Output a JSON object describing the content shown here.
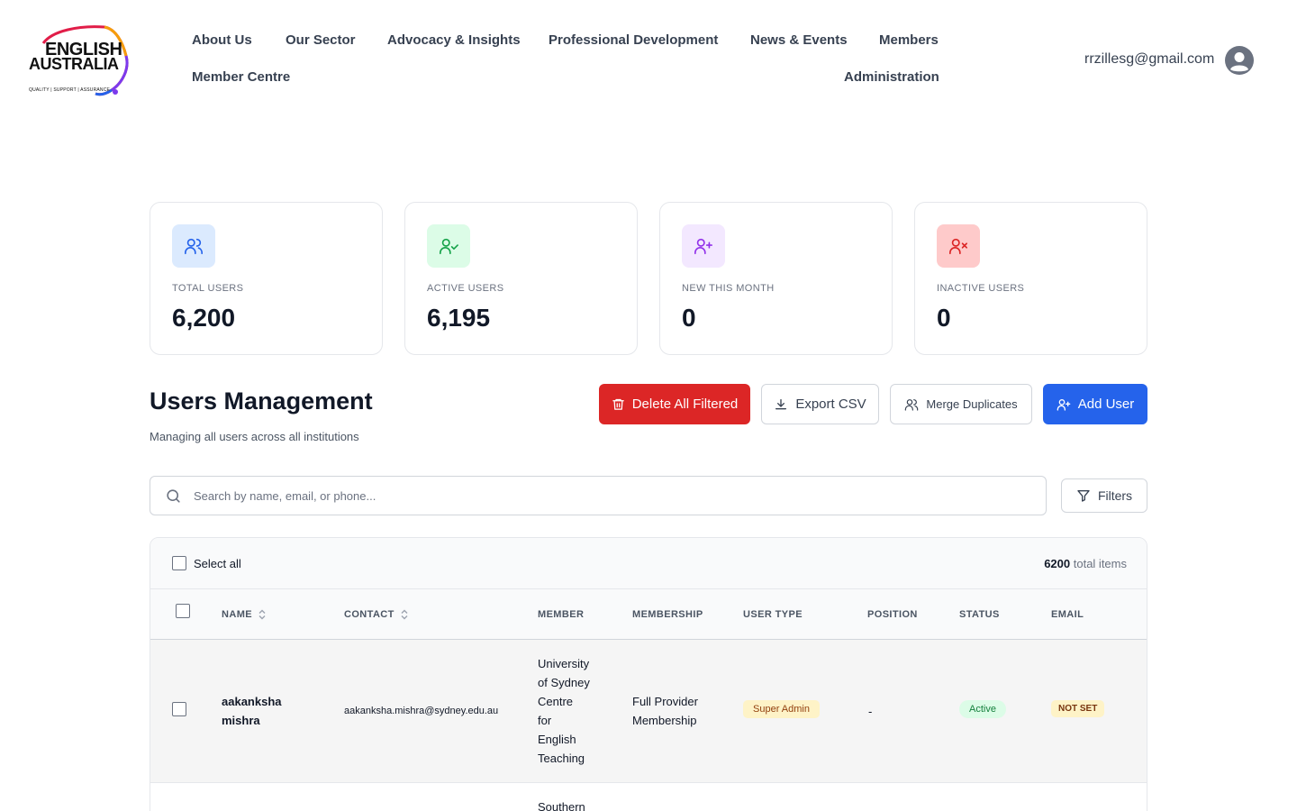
{
  "brand": {
    "line1": "ENGLISH",
    "line2": "AUSTRALIA",
    "tagline": "QUALITY | SUPPORT | ASSURANCE"
  },
  "nav": {
    "about": "About Us",
    "sector": "Our Sector",
    "advocacy": "Advocacy & Insights",
    "development": "Professional Development",
    "news": "News & Events",
    "members": "Members",
    "member_centre": "Member Centre",
    "administration": "Administration"
  },
  "user": {
    "email": "rrzillesg@gmail.com"
  },
  "stats": [
    {
      "label": "TOTAL USERS",
      "value": "6,200",
      "icon": "users-icon",
      "bg": "#dbeafe",
      "fg": "#2563eb"
    },
    {
      "label": "ACTIVE USERS",
      "value": "6,195",
      "icon": "user-check-icon",
      "bg": "#dcfce7",
      "fg": "#16a34a"
    },
    {
      "label": "NEW THIS MONTH",
      "value": "0",
      "icon": "user-plus-icon",
      "bg": "#f3e8ff",
      "fg": "#9333ea"
    },
    {
      "label": "INACTIVE USERS",
      "value": "0",
      "icon": "user-x-icon",
      "bg": "#fee2e2",
      "fg": "#dc2626"
    }
  ],
  "page": {
    "title": "Users Management",
    "subtitle": "Managing all users across all institutions"
  },
  "actions": {
    "delete": "Delete All Filtered",
    "export": "Export CSV",
    "merge": "Merge Duplicates",
    "add": "Add User"
  },
  "search": {
    "placeholder": "Search by name, email, or phone...",
    "value": ""
  },
  "filters_label": "Filters",
  "table": {
    "select_all": "Select all",
    "total_count": "6200",
    "total_suffix": "total items",
    "columns": {
      "name": "NAME",
      "contact": "CONTACT",
      "member": "MEMBER",
      "membership": "MEMBERSHIP",
      "user_type": "USER TYPE",
      "position": "POSITION",
      "status": "STATUS",
      "email": "EMAIL"
    },
    "rows": [
      {
        "name_first": "aakanksha",
        "name_last": "mishra",
        "contact": "aakanksha.mishra@sydney.edu.au",
        "member_lines": [
          "University",
          "of Sydney",
          "Centre",
          "for",
          "English",
          "Teaching"
        ],
        "membership_line1": "Full Provider",
        "membership_line2": "Membership",
        "user_type": "Super Admin",
        "position": "-",
        "status": "Active",
        "email_status": "NOT SET"
      },
      {
        "member_lines": [
          "Southern"
        ]
      }
    ]
  }
}
